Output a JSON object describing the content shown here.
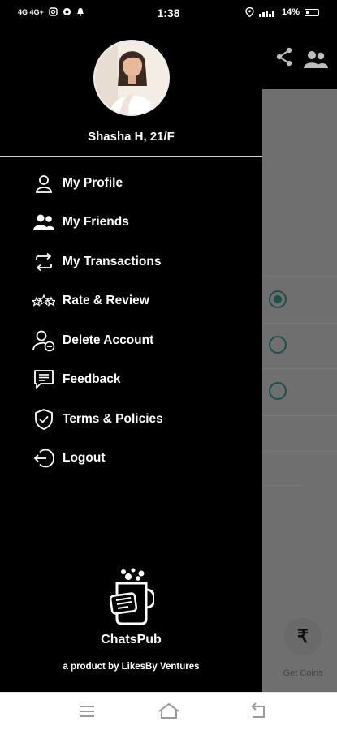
{
  "status_bar": {
    "left_indicators": "4G 4G+",
    "time": "1:38",
    "battery": "14%"
  },
  "drawer": {
    "user_name": "Shasha H, 21/F",
    "menu": [
      {
        "label": "My Profile",
        "icon": "user-icon"
      },
      {
        "label": "My Friends",
        "icon": "friends-icon"
      },
      {
        "label": "My Transactions",
        "icon": "transactions-icon"
      },
      {
        "label": "Rate & Review",
        "icon": "stars-icon"
      },
      {
        "label": "Delete Account",
        "icon": "delete-account-icon"
      },
      {
        "label": "Feedback",
        "icon": "feedback-icon"
      },
      {
        "label": "Terms & Policies",
        "icon": "shield-check-icon"
      },
      {
        "label": "Logout",
        "icon": "logout-icon"
      }
    ],
    "brand_name": "ChatsPub",
    "brand_tagline": "a product by LikesBy Ventures"
  },
  "background_screen": {
    "currency_symbol": "₹",
    "get_coins_label": "Get Coins"
  },
  "colors": {
    "drawer_bg": "#000000",
    "text": "#ffffff",
    "radio_accent": "#1d4f4c",
    "overlay": "#6f6f6f"
  }
}
